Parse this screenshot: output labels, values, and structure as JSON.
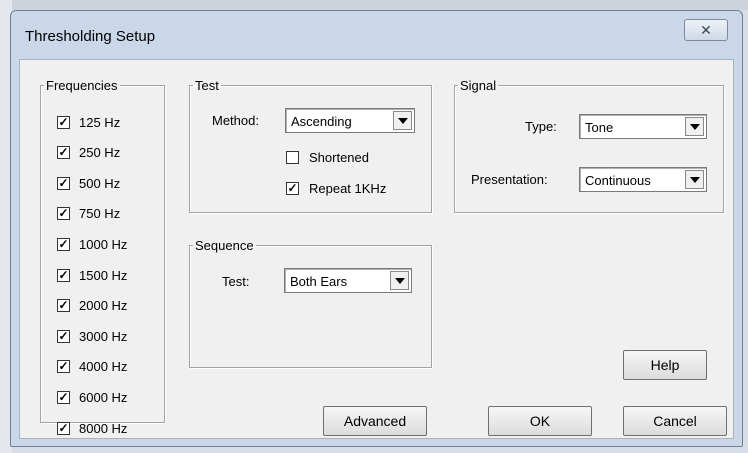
{
  "dialog": {
    "title": "Thresholding Setup",
    "close_glyph": "✕"
  },
  "frequencies": {
    "legend": "Frequencies",
    "items": [
      {
        "label": "125 Hz",
        "checked": true
      },
      {
        "label": "250 Hz",
        "checked": true
      },
      {
        "label": "500 Hz",
        "checked": true
      },
      {
        "label": "750 Hz",
        "checked": true
      },
      {
        "label": "1000 Hz",
        "checked": true
      },
      {
        "label": "1500 Hz",
        "checked": true
      },
      {
        "label": "2000 Hz",
        "checked": true
      },
      {
        "label": "3000 Hz",
        "checked": true
      },
      {
        "label": "4000 Hz",
        "checked": true
      },
      {
        "label": "6000 Hz",
        "checked": true
      },
      {
        "label": "8000 Hz",
        "checked": true
      }
    ]
  },
  "test": {
    "legend": "Test",
    "method_label": "Method:",
    "method_value": "Ascending",
    "shortened": {
      "label": "Shortened",
      "checked": false
    },
    "repeat": {
      "label": "Repeat 1KHz",
      "checked": true
    }
  },
  "sequence": {
    "legend": "Sequence",
    "test_label": "Test:",
    "test_value": "Both Ears"
  },
  "signal": {
    "legend": "Signal",
    "type_label": "Type:",
    "type_value": "Tone",
    "presentation_label": "Presentation:",
    "presentation_value": "Continuous"
  },
  "buttons": {
    "help": "Help",
    "advanced": "Advanced",
    "ok": "OK",
    "cancel": "Cancel"
  }
}
